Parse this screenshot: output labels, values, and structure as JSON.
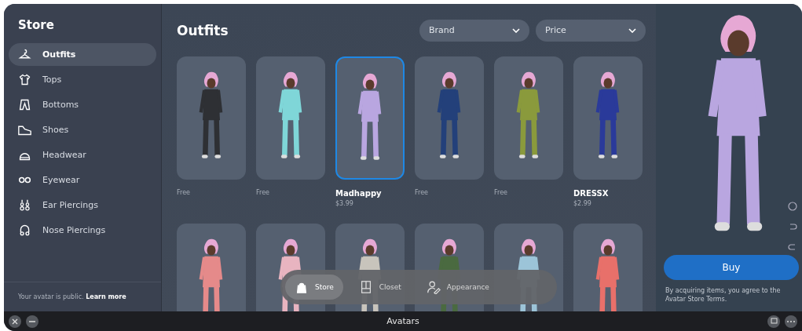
{
  "sidebar": {
    "title": "Store",
    "items": [
      {
        "label": "Outfits",
        "selected": true
      },
      {
        "label": "Tops",
        "selected": false
      },
      {
        "label": "Bottoms",
        "selected": false
      },
      {
        "label": "Shoes",
        "selected": false
      },
      {
        "label": "Headwear",
        "selected": false
      },
      {
        "label": "Eyewear",
        "selected": false
      },
      {
        "label": "Ear Piercings",
        "selected": false
      },
      {
        "label": "Nose Piercings",
        "selected": false
      }
    ],
    "footer": {
      "text": "Your avatar is public.",
      "link": "Learn more"
    }
  },
  "main": {
    "title": "Outfits",
    "filters": [
      {
        "label": "Brand"
      },
      {
        "label": "Price"
      }
    ],
    "outfits": [
      {
        "price": "Free",
        "selected": false,
        "color": "#2e3034"
      },
      {
        "price": "Free",
        "selected": false,
        "color": "#7fd6d8"
      },
      {
        "name": "Madhappy",
        "price": "$3.99",
        "selected": true,
        "color": "#b9a6e0"
      },
      {
        "price": "Free",
        "selected": false,
        "color": "#23407a"
      },
      {
        "price": "Free",
        "selected": false,
        "color": "#8a9a3c"
      },
      {
        "name": "DRESSX",
        "price": "$2.99",
        "selected": false,
        "color": "#2a3a9a"
      },
      {
        "selected": false,
        "color": "#e58a8a"
      },
      {
        "selected": false,
        "color": "#e8b4c0"
      },
      {
        "selected": false,
        "color": "#c8c4bc"
      },
      {
        "selected": false,
        "color": "#4a6a40"
      },
      {
        "selected": false,
        "color": "#9cc4d8"
      },
      {
        "selected": false,
        "color": "#e8706a"
      }
    ]
  },
  "dock": [
    {
      "label": "Store",
      "selected": true
    },
    {
      "label": "Closet",
      "selected": false
    },
    {
      "label": "Appearance",
      "selected": false
    }
  ],
  "preview": {
    "buy": "Buy",
    "terms": "By acquiring items, you agree to the Avatar Store Terms."
  },
  "taskbar": {
    "title": "Avatars"
  }
}
